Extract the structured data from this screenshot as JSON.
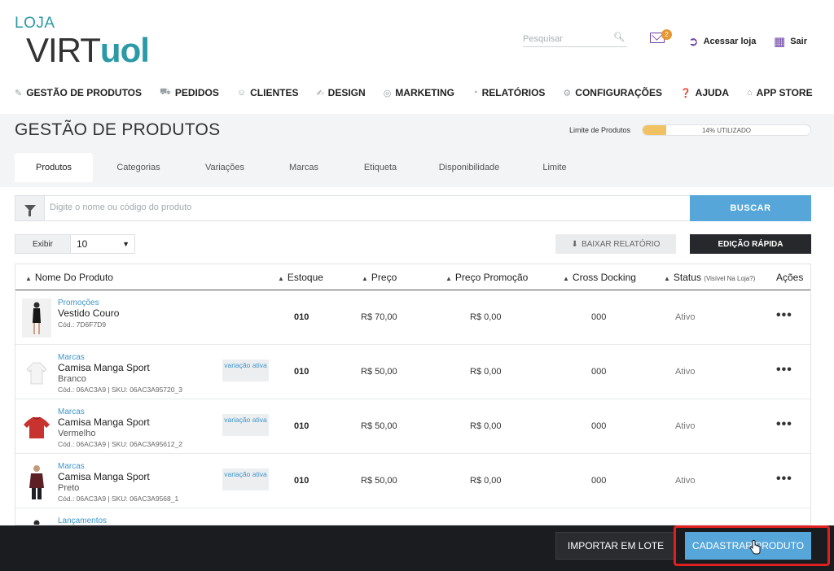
{
  "header": {
    "logo_top": "LOJA",
    "logo_virt": "VIRT",
    "logo_uol": "UOL",
    "search_placeholder": "Pesquisar",
    "mail_count": "2",
    "acessar_loja": "Acessar loja",
    "sair": "Sair",
    "accent_color": "#6a3fa2"
  },
  "nav": [
    {
      "label": "GESTÃO DE PRODUTOS",
      "icon": "edit-icon"
    },
    {
      "label": "PEDIDOS",
      "icon": "cart-icon"
    },
    {
      "label": "CLIENTES",
      "icon": "user-icon"
    },
    {
      "label": "DESIGN",
      "icon": "brush-icon"
    },
    {
      "label": "MARKETING",
      "icon": "target-icon"
    },
    {
      "label": "RELATÓRIOS",
      "icon": "pie-chart-icon"
    },
    {
      "label": "CONFIGURAÇÕES",
      "icon": "gears-icon"
    },
    {
      "label": "AJUDA",
      "icon": "help-icon"
    },
    {
      "label": "APP STORE",
      "icon": "store-icon"
    }
  ],
  "page": {
    "title": "GESTÃO DE PRODUTOS",
    "limit_label": "Limite de Produtos",
    "limit_text": "14% UTILIZADO",
    "limit_fraction": 0.14
  },
  "tabs": [
    {
      "label": "Produtos",
      "active": true
    },
    {
      "label": "Categorias",
      "active": false
    },
    {
      "label": "Variações",
      "active": false
    },
    {
      "label": "Marcas",
      "active": false
    },
    {
      "label": "Etiqueta",
      "active": false
    },
    {
      "label": "Disponibilidade",
      "active": false
    },
    {
      "label": "Limite",
      "active": false
    }
  ],
  "filter": {
    "placeholder": "Digite o nome ou código do produto",
    "search_button": "BUSCAR"
  },
  "controls": {
    "exibir_label": "Exibir",
    "exibir_value": "10",
    "baixar_relatorio": "BAIXAR RELATÓRIO",
    "edicao_rapida": "EDIÇÃO RÁPIDA"
  },
  "table": {
    "headers": {
      "nome": "Nome Do Produto",
      "estoque": "Estoque",
      "preco": "Preço",
      "preco_promocao": "Preço Promoção",
      "cross_docking": "Cross Docking",
      "status": "Status",
      "status_note": "(Visível Na Loja?)",
      "acoes": "Ações"
    },
    "rows": [
      {
        "category": "Promoções",
        "name": "Vestido Couro",
        "variant": "",
        "code": "Cód.: 7D6F7D9",
        "badge": "",
        "estoque": "010",
        "preco": "R$ 70,00",
        "promo": "R$ 0,00",
        "cross": "000",
        "status": "Ativo",
        "actions": "•••"
      },
      {
        "category": "Marcas",
        "name": "Camisa Manga Sport",
        "variant": "Branco",
        "code": "Cód.: 06AC3A9 | SKU: 06AC3A95720_3",
        "badge": "variação ativa",
        "estoque": "010",
        "preco": "R$ 50,00",
        "promo": "R$ 0,00",
        "cross": "000",
        "status": "Ativo",
        "actions": "•••"
      },
      {
        "category": "Marcas",
        "name": "Camisa Manga Sport",
        "variant": "Vermelho",
        "code": "Cód.: 06AC3A9 | SKU: 06AC3A95612_2",
        "badge": "variação ativa",
        "estoque": "010",
        "preco": "R$ 50,00",
        "promo": "R$ 0,00",
        "cross": "000",
        "status": "Ativo",
        "actions": "•••"
      },
      {
        "category": "Marcas",
        "name": "Camisa Manga Sport",
        "variant": "Preto",
        "code": "Cód.: 06AC3A9 | SKU: 06AC3A9568_1",
        "badge": "variação ativa",
        "estoque": "010",
        "preco": "R$ 50,00",
        "promo": "R$ 0,00",
        "cross": "000",
        "status": "Ativo",
        "actions": "•••"
      },
      {
        "category": "Lançamentos",
        "name": "",
        "variant": "",
        "code": "",
        "badge": "",
        "estoque": "",
        "preco": "",
        "promo": "",
        "cross": "",
        "status": "",
        "actions": ""
      }
    ]
  },
  "footer": {
    "importar": "IMPORTAR EM LOTE",
    "cadastrar": "CADASTRAR PRODUTO",
    "highlight_color": "#e02020"
  }
}
